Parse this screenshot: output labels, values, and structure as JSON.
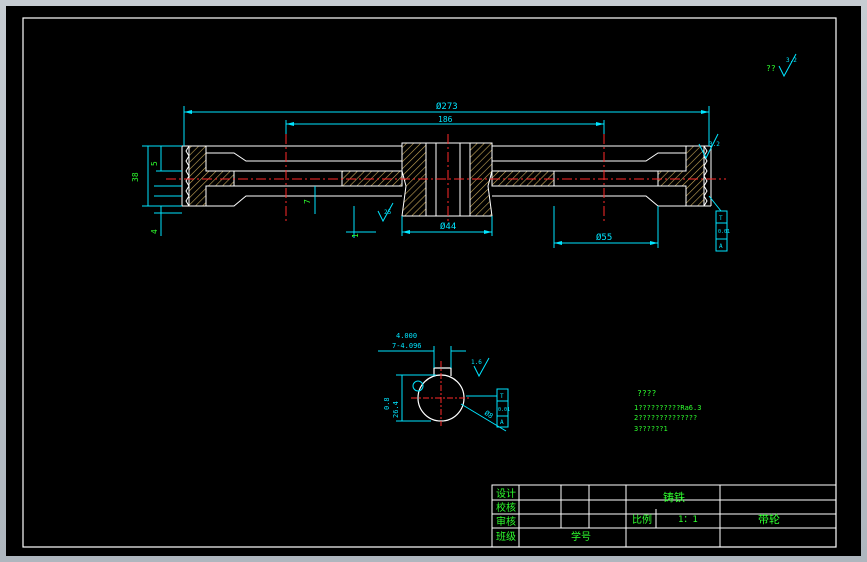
{
  "dimensions": {
    "outer_diameter": "Ø273",
    "pitch_span": "186",
    "hub_diameter": "Ø44",
    "hole_diameter": "Ø55",
    "width": "38",
    "rim_offset": "5",
    "web_thickness": "7",
    "lower_offset": "4",
    "small_dim": "1"
  },
  "roughness": {
    "top_right": "??",
    "top_right_value": "3.2",
    "rim_value": "3.2",
    "web_value": "25",
    "keyway_value": "1.6"
  },
  "section_view": {
    "key_width": "4.000",
    "key_tol": "7-4.096",
    "depth": "0.8",
    "hub_size": "26.4",
    "note": "Ø8"
  },
  "tech_notes": {
    "title": "????",
    "line1": "1??????????Ra6.3",
    "line2": "2??????????????",
    "line3": "3??????1"
  },
  "gdt": {
    "frame1": [
      "T",
      "0.01",
      "A"
    ],
    "frame2": [
      "T",
      "0.01",
      "A"
    ]
  },
  "title_block": {
    "design": "设计",
    "check": "校核",
    "review": "审核",
    "class": "班级",
    "student_id": "学号",
    "material": "铸铁",
    "scale_label": "比例",
    "scale_value": "1：1",
    "part_name": "带轮"
  },
  "colors": {
    "outline": "#ffffff",
    "dimension": "#00e5ff",
    "text": "#2eff2e",
    "centerline": "#ff2a2a",
    "hatch": "#c8a85a"
  }
}
